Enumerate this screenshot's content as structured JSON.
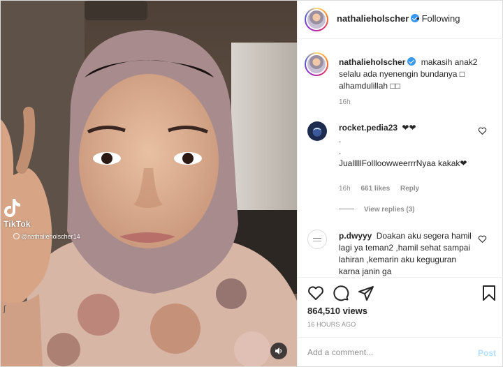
{
  "media": {
    "watermark": {
      "brand": "TikTok",
      "handle": "@nathalieholscher14"
    },
    "icons": {
      "tiktok": "tiktok-logo-icon",
      "sound": "speaker-icon"
    }
  },
  "header": {
    "username": "nathalieholscher",
    "separator": "•",
    "follow_status": "Following"
  },
  "caption": {
    "username": "nathalieholscher",
    "text": "makasih anak2 selalu ada nyenengin bundanya □ alhamdulillah □□",
    "time": "16h"
  },
  "comments": [
    {
      "username": "rocket.pedia23",
      "text": "❤❤\n.\n.\nJualllllFollloowweerrrNyaa kakak❤",
      "time": "16h",
      "likes": "661 likes",
      "reply_label": "Reply",
      "view_replies": "View replies (3)"
    },
    {
      "username": "p.dwyyy",
      "text": "Doakan aku segera hamil lagi ya teman2 ,hamil sehat sampai lahiran ,kemarin aku keguguran karna janin ga"
    }
  ],
  "actions": {
    "views": "864,510 views",
    "posted_ago": "16 HOURS AGO",
    "icons": [
      "heart-icon",
      "comment-icon",
      "share-icon",
      "bookmark-icon"
    ]
  },
  "comment_box": {
    "placeholder": "Add a comment...",
    "post_label": "Post"
  },
  "colors": {
    "verified": "#3897f0",
    "post_disabled": "#b2dffc",
    "meta_gray": "#8e8e8e"
  }
}
